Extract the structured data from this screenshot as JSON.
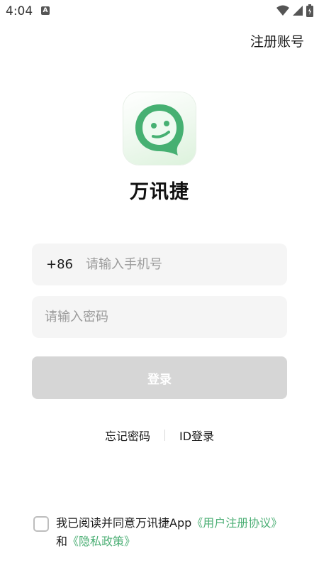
{
  "status_bar": {
    "time": "4:04",
    "notification_icon": "A",
    "icons": [
      "wifi-icon",
      "signal-icon",
      "battery-icon"
    ]
  },
  "header": {
    "register_label": "注册账号"
  },
  "app": {
    "name": "万讯捷",
    "logo_icon": "smile-chat-bubble-icon",
    "brand_color": "#46b072"
  },
  "form": {
    "country_code": "+86",
    "phone_placeholder": "请输入手机号",
    "password_placeholder": "请输入密码",
    "login_label": "登录"
  },
  "links": {
    "forgot_password": "忘记密码",
    "id_login": "ID登录"
  },
  "agreement": {
    "prefix": "我已阅读并同意万讯捷App",
    "user_agreement": "《用户注册协议》",
    "and": "和",
    "privacy_policy": "《隐私政策》",
    "link_color": "#4caf75"
  }
}
